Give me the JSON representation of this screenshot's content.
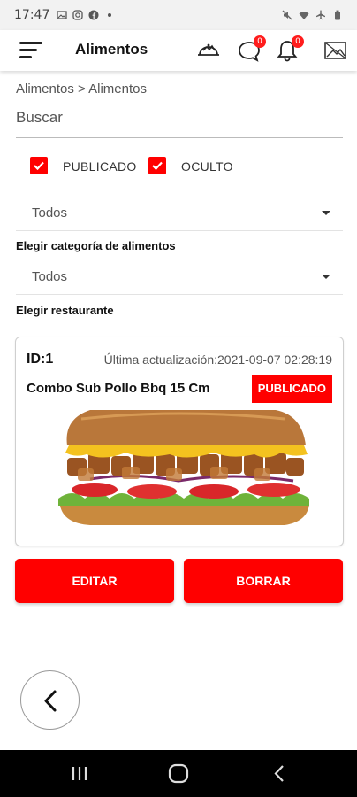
{
  "status_bar": {
    "time": "17:47",
    "left_icons": [
      "gallery-icon",
      "instagram-icon",
      "facebook-icon",
      "dot-icon"
    ],
    "right_icons": [
      "mute-icon",
      "wifi-icon",
      "airplane-icon",
      "battery-icon"
    ]
  },
  "app_bar": {
    "title": "Alimentos",
    "chat_badge": "0",
    "bell_badge": "0",
    "icons": [
      "menu-icon",
      "restaurant-icon",
      "chat-icon",
      "bell-icon",
      "image-icon"
    ]
  },
  "breadcrumb": "Alimentos > Alimentos",
  "search": {
    "placeholder": "Buscar",
    "value": ""
  },
  "filters": {
    "published_label": "PUBLICADO",
    "published_checked": true,
    "hidden_label": "OCULTO",
    "hidden_checked": true
  },
  "category_select": {
    "value": "Todos",
    "label": "Elegir categoría de alimentos"
  },
  "restaurant_select": {
    "value": "Todos",
    "label": "Elegir restaurante"
  },
  "item": {
    "id": "ID:1",
    "updated": "Última actualización:2021-09-07 02:28:19",
    "name": "Combo Sub Pollo Bbq 15 Cm",
    "status": "PUBLICADO",
    "image": "sandwich-image"
  },
  "actions": {
    "edit_label": "EDITAR",
    "delete_label": "BORRAR"
  },
  "colors": {
    "accent": "#ff0000",
    "text": "#111111",
    "status_bar": "#f2f2f2",
    "nav_bar": "#000000"
  }
}
